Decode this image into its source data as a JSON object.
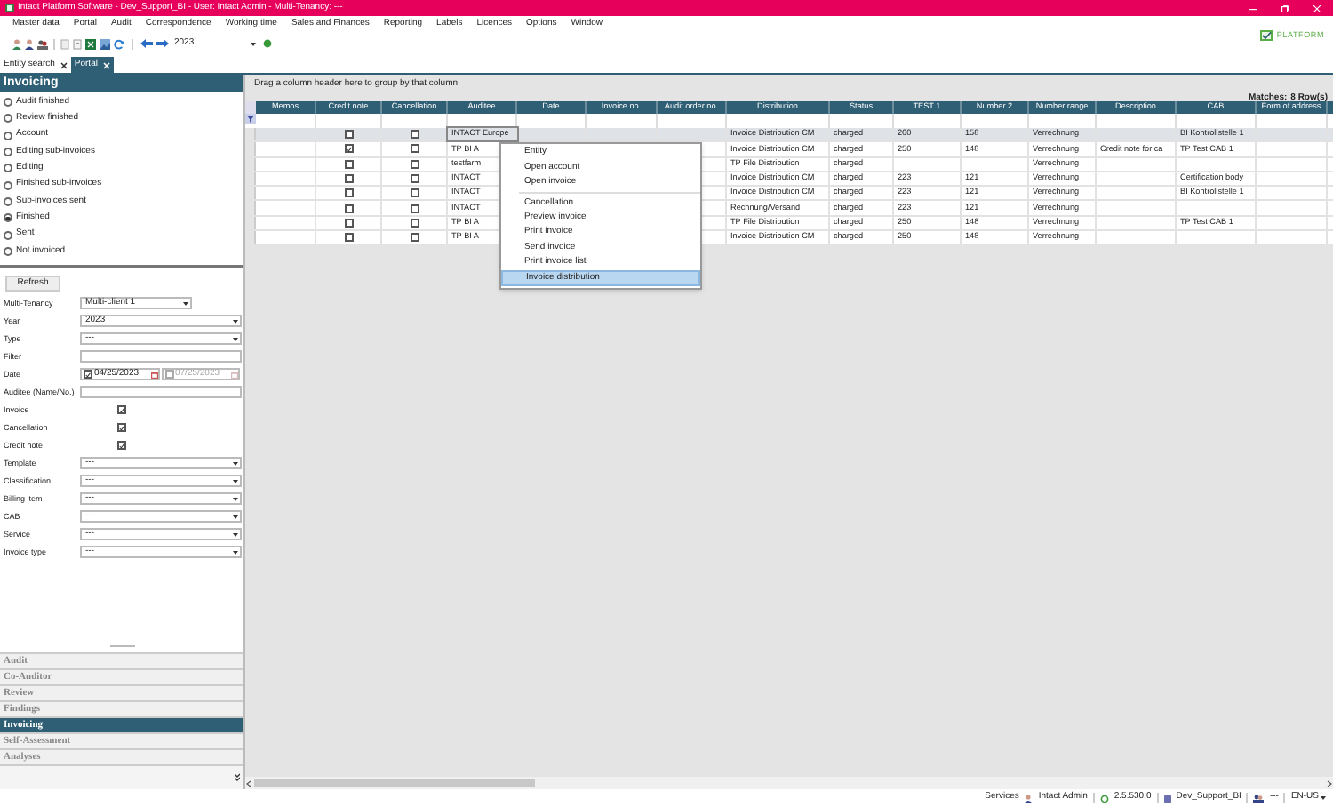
{
  "window": {
    "title": "Intact Platform Software - Dev_Support_BI - User: Intact Admin - Multi-Tenancy: ---"
  },
  "menu_bar": [
    "Master data",
    "Portal",
    "Audit",
    "Correspondence",
    "Working time",
    "Sales and Finances",
    "Reporting",
    "Labels",
    "Licences",
    "Options",
    "Window"
  ],
  "toolbar": {
    "year": "2023"
  },
  "logo": {
    "text": "PLATFORM"
  },
  "tabs": [
    {
      "label": "Entity search",
      "selected": false
    },
    {
      "label": "Portal",
      "selected": true
    }
  ],
  "left_panel": {
    "title": "Invoicing",
    "statuses": [
      {
        "label": "Audit finished",
        "selected": false
      },
      {
        "label": "Review finished",
        "selected": false
      },
      {
        "label": "Account",
        "selected": false
      },
      {
        "label": "Editing sub-invoices",
        "selected": false
      },
      {
        "label": "Editing",
        "selected": false
      },
      {
        "label": "Finished sub-invoices",
        "selected": false
      },
      {
        "label": "Sub-invoices sent",
        "selected": false
      },
      {
        "label": "Finished",
        "selected": true
      },
      {
        "label": "Sent",
        "selected": false
      },
      {
        "label": "Not invoiced",
        "selected": false
      }
    ],
    "refresh_button": "Refresh",
    "filters": [
      {
        "kind": "select",
        "label": "Multi-Tenancy",
        "value": "Multi-client 1"
      },
      {
        "kind": "select",
        "label": "Year",
        "value": "2023"
      },
      {
        "kind": "select",
        "label": "Type",
        "value": "---"
      },
      {
        "kind": "text",
        "label": "Filter"
      },
      {
        "kind": "date",
        "label": "Date",
        "from": {
          "checked": true,
          "value": "04/25/2023"
        },
        "to": {
          "checked": false,
          "value": "07/25/2023"
        }
      },
      {
        "kind": "text",
        "label": "Auditee (Name/No.)"
      },
      {
        "kind": "checkbox",
        "label": "Invoice",
        "checked": true
      },
      {
        "kind": "checkbox",
        "label": "Cancellation",
        "checked": true
      },
      {
        "kind": "checkbox",
        "label": "Credit note",
        "checked": true
      },
      {
        "kind": "select",
        "label": "Template",
        "value": "---"
      },
      {
        "kind": "select",
        "label": "Classification",
        "value": "---"
      },
      {
        "kind": "select",
        "label": "Billing item",
        "value": "---"
      },
      {
        "kind": "select",
        "label": "CAB",
        "value": "---"
      },
      {
        "kind": "select",
        "label": "Service",
        "value": "---"
      },
      {
        "kind": "select",
        "label": "Invoice type",
        "value": "---"
      }
    ],
    "sections": [
      {
        "label": "Audit",
        "selected": false
      },
      {
        "label": "Co-Auditor",
        "selected": false
      },
      {
        "label": "Review",
        "selected": false
      },
      {
        "label": "Findings",
        "selected": false
      },
      {
        "label": "Invoicing",
        "selected": true
      },
      {
        "label": "Self-Assessment",
        "selected": false
      },
      {
        "label": "Analyses",
        "selected": false
      }
    ]
  },
  "grid": {
    "group_hint": "Drag a column header here to group by that column",
    "matches_label": "Matches:",
    "matches": "8 Row(s)",
    "columns": [
      "Memos",
      "Credit note",
      "Cancellation",
      "Auditee",
      "Date",
      "Invoice no.",
      "Audit order no.",
      "Distribution",
      "Status",
      "TEST 1",
      "Number 2",
      "Number range",
      "Description",
      "CAB",
      "Form of address"
    ],
    "rows": [
      {
        "selected": true,
        "credit_note": false,
        "cancellation": false,
        "auditee": "INTACT Europe",
        "distribution": "Invoice Distribution CM",
        "status": "charged",
        "test_1": "260",
        "number_2": "158",
        "number_range": "Verrechnung",
        "cab": "BI Kontrollstelle 1"
      },
      {
        "selected": false,
        "credit_note": true,
        "cancellation": false,
        "auditee": "TP BI A",
        "distribution": "Invoice Distribution CM",
        "status": "charged",
        "test_1": "250",
        "number_2": "148",
        "number_range": "Verrechnung",
        "description": "Credit note for ca",
        "cab": "TP Test CAB 1"
      },
      {
        "selected": false,
        "credit_note": false,
        "cancellation": false,
        "auditee": "testfarm",
        "distribution": "TP File Distribution",
        "status": "charged",
        "number_range": "Verrechnung"
      },
      {
        "selected": false,
        "credit_note": false,
        "cancellation": false,
        "auditee": "INTACT",
        "distribution": "Invoice Distribution CM",
        "status": "charged",
        "test_1": "223",
        "number_2": "121",
        "number_range": "Verrechnung",
        "cab": "Certification body"
      },
      {
        "selected": false,
        "credit_note": false,
        "cancellation": false,
        "auditee": "INTACT",
        "distribution": "Invoice Distribution CM",
        "status": "charged",
        "test_1": "223",
        "number_2": "121",
        "number_range": "Verrechnung",
        "cab": "BI Kontrollstelle 1"
      },
      {
        "selected": false,
        "credit_note": false,
        "cancellation": false,
        "auditee": "INTACT",
        "distribution": "Rechnung/Versand",
        "status": "charged",
        "test_1": "223",
        "number_2": "121",
        "number_range": "Verrechnung"
      },
      {
        "selected": false,
        "credit_note": false,
        "cancellation": false,
        "auditee": "TP BI A",
        "distribution": "TP File Distribution",
        "status": "charged",
        "test_1": "250",
        "number_2": "148",
        "number_range": "Verrechnung",
        "cab": "TP Test CAB 1"
      },
      {
        "selected": false,
        "credit_note": false,
        "cancellation": false,
        "auditee": "TP BI A",
        "distribution": "Invoice Distribution CM",
        "status": "charged",
        "test_1": "250",
        "number_2": "148",
        "number_range": "Verrechnung"
      }
    ]
  },
  "context_menu": {
    "groups": [
      [
        {
          "label": "Entity",
          "selected": false
        },
        {
          "label": "Open account",
          "selected": false
        },
        {
          "label": "Open invoice",
          "selected": false
        }
      ],
      [
        {
          "label": "Cancellation",
          "selected": false
        },
        {
          "label": "Preview invoice",
          "selected": false
        },
        {
          "label": "Print invoice",
          "selected": false
        },
        {
          "label": "Send invoice",
          "selected": false
        },
        {
          "label": "Print invoice list",
          "selected": false
        },
        {
          "label": "Invoice distribution",
          "selected": true
        }
      ]
    ]
  },
  "status_bar": {
    "services": "Services",
    "user": "Intact Admin",
    "version": "2.5.530.0",
    "database": "Dev_Support_BI",
    "tenancy": "---",
    "language": "EN-US"
  }
}
